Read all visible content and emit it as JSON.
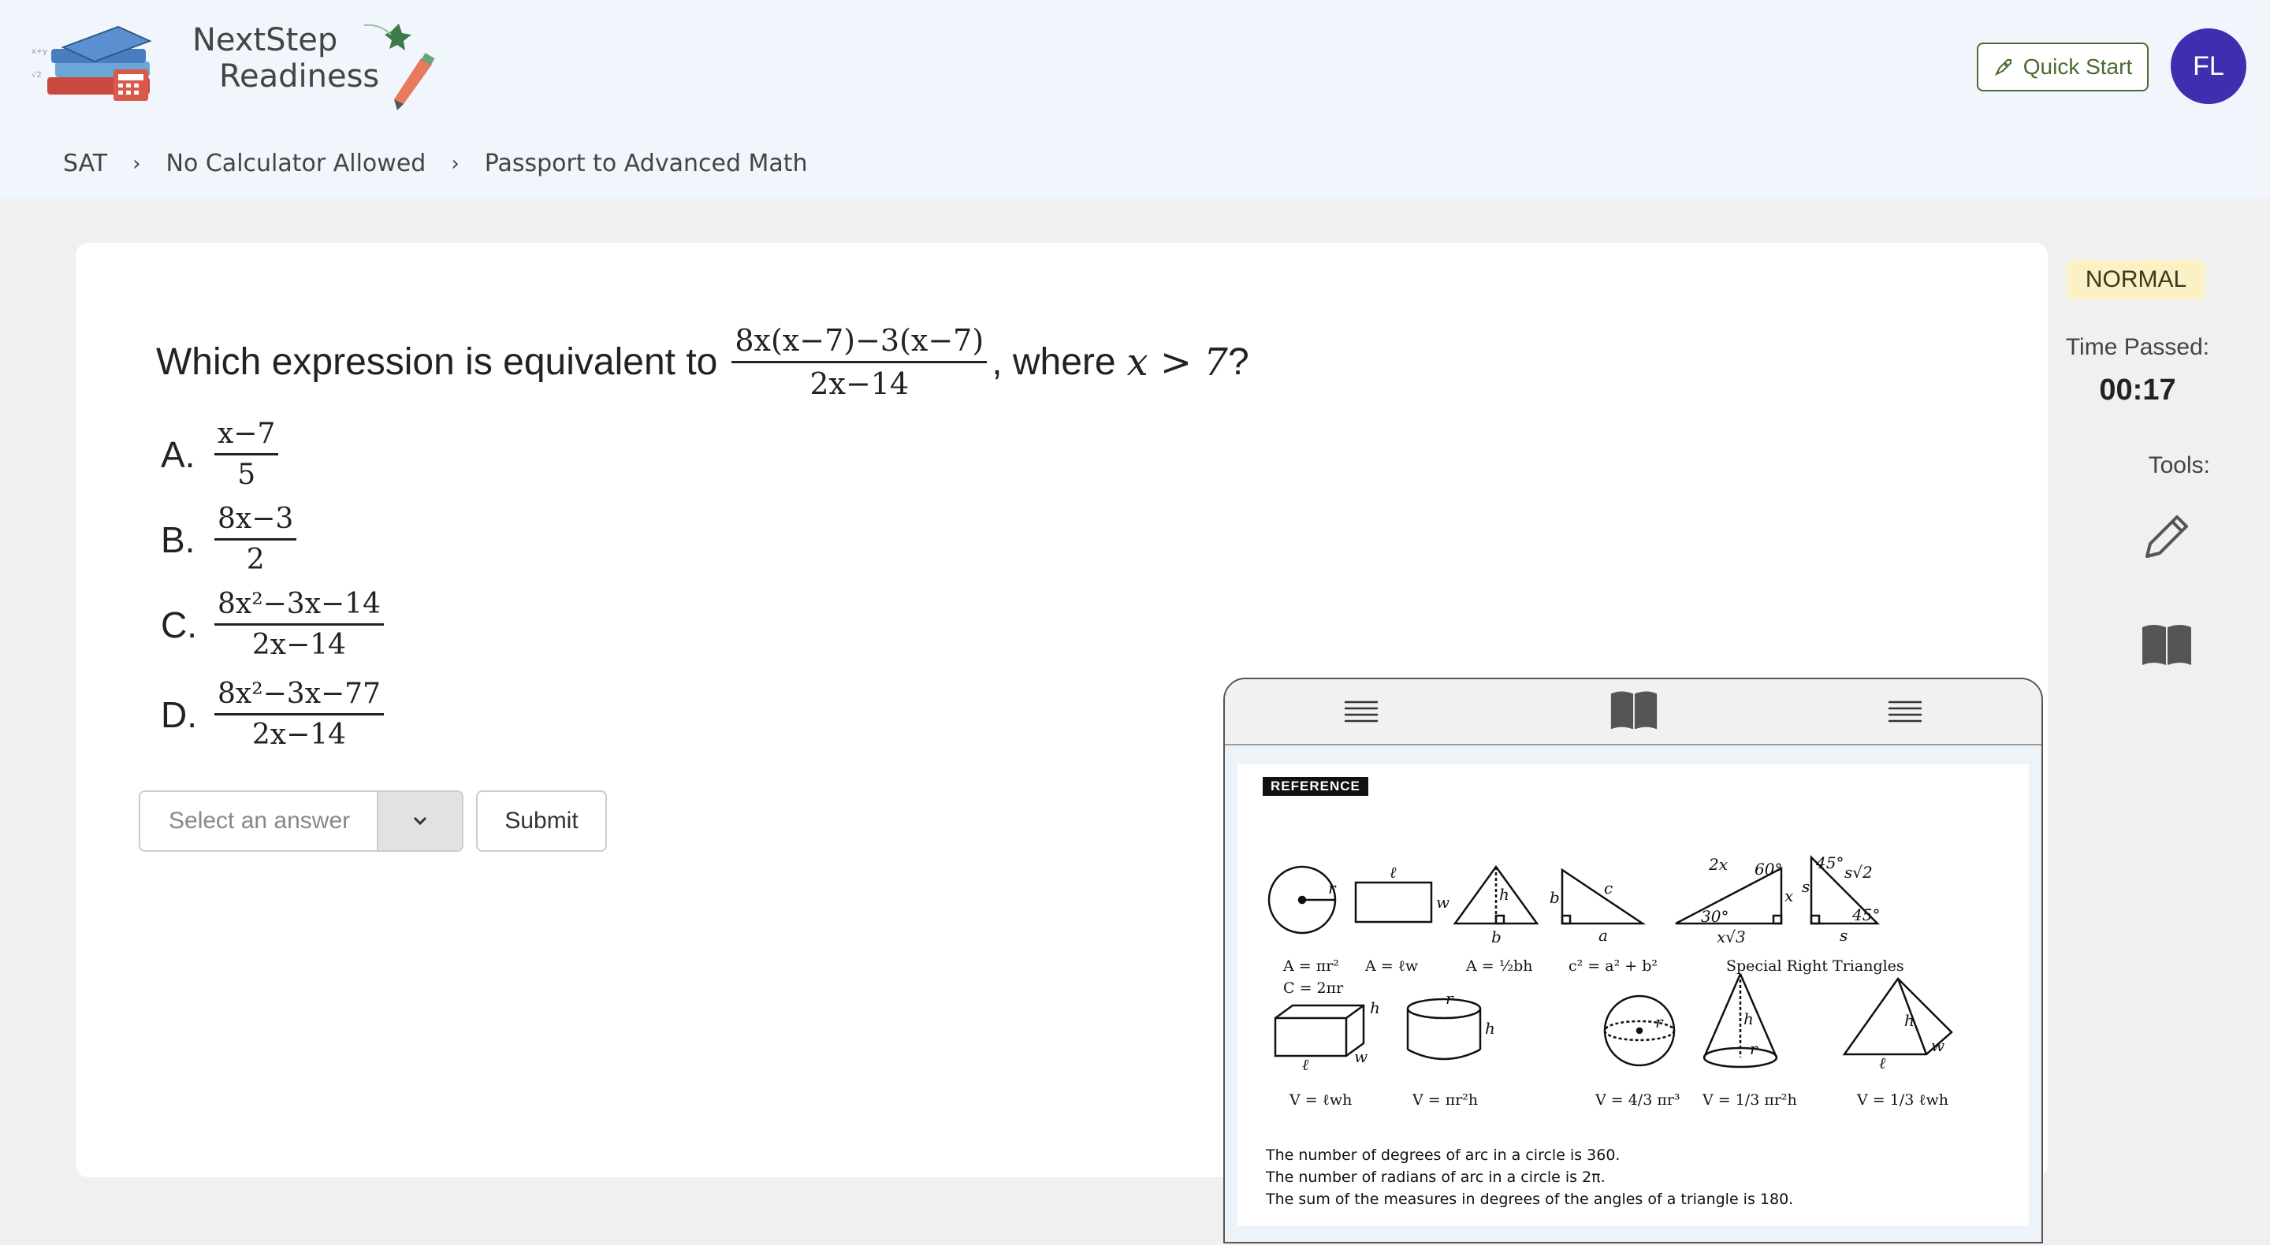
{
  "header": {
    "logo_line1": "NextStep",
    "logo_line2": "Readiness",
    "quick_start": "Quick Start",
    "avatar_initials": "FL"
  },
  "breadcrumb": [
    "SAT",
    "No Calculator Allowed",
    "Passport to Advanced Math"
  ],
  "question": {
    "prefix": "Which expression is equivalent to",
    "numerator": "8x(x−7)−3(x−7)",
    "denominator": "2x−14",
    "suffix_text": ", where",
    "condition": "x > 7",
    "end": "?"
  },
  "options": [
    {
      "letter": "A.",
      "num": "x−7",
      "den": "5"
    },
    {
      "letter": "B.",
      "num": "8x−3",
      "den": "2"
    },
    {
      "letter": "C.",
      "num": "8x²−3x−14",
      "den": "2x−14"
    },
    {
      "letter": "D.",
      "num": "8x²−3x−77",
      "den": "2x−14"
    }
  ],
  "answer": {
    "placeholder": "Select an answer",
    "submit": "Submit"
  },
  "sidebar": {
    "mode": "NORMAL",
    "time_label": "Time Passed:",
    "time_value": "00:17",
    "tools_label": "Tools:"
  },
  "reference": {
    "title": "REFERENCE",
    "formulas": {
      "circle_area": "A = πr²",
      "circle_circ": "C = 2πr",
      "rect_area": "A = ℓw",
      "tri_area": "A = ½bh",
      "pyth": "c² = a² + b²",
      "special": "Special Right Triangles",
      "box_vol": "V = ℓwh",
      "cyl_vol": "V = πr²h",
      "sphere_vol": "V = 4/3 πr³",
      "cone_vol": "V = 1/3 πr²h",
      "pyramid_vol": "V = 1/3 ℓwh"
    },
    "notes": [
      "The number of degrees of arc in a circle is 360.",
      "The number of radians of arc in a circle is 2π.",
      "The sum of the measures in degrees of the angles of a triangle is 180."
    ]
  },
  "colors": {
    "header_bg": "#f0f6fb",
    "page_bg": "#f0f0f0",
    "accent_green": "#4a6b2f",
    "avatar_bg": "#3f2fb0",
    "badge_bg": "#fbf1c5"
  },
  "icons": [
    "books-logo-icon",
    "pen-logo-icon",
    "rocket-icon",
    "chevron-right-icon",
    "chevron-down-icon",
    "pencil-icon",
    "book-icon",
    "menu-icon"
  ]
}
